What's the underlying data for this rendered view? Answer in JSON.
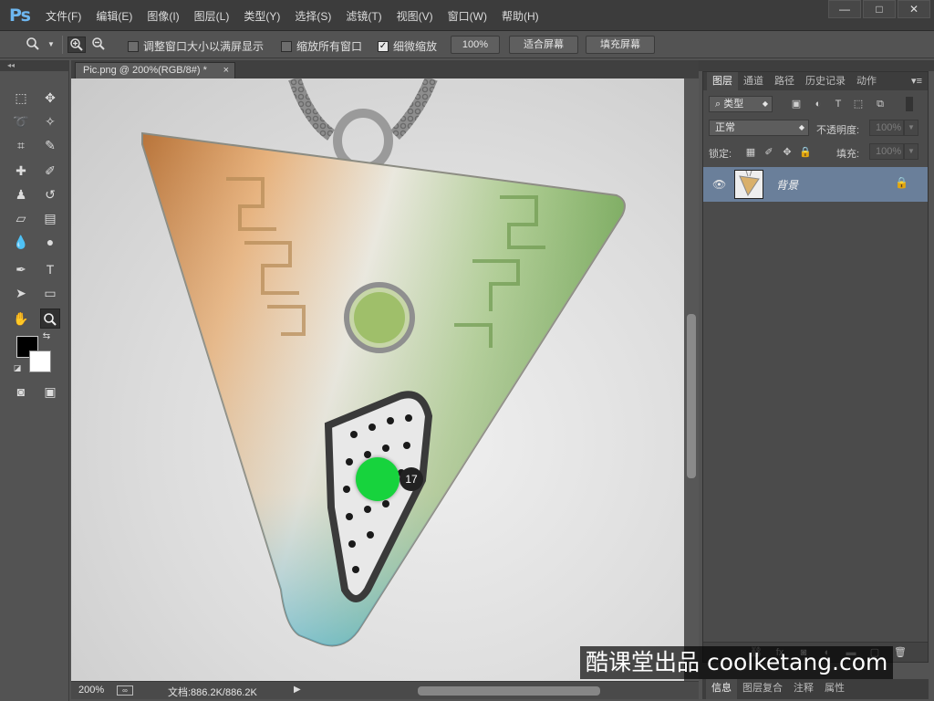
{
  "app": {
    "logo": "Ps"
  },
  "menu": [
    "文件(F)",
    "编辑(E)",
    "图像(I)",
    "图层(L)",
    "类型(Y)",
    "选择(S)",
    "滤镜(T)",
    "视图(V)",
    "窗口(W)",
    "帮助(H)"
  ],
  "window_controls": {
    "minimize": "—",
    "maximize": "□",
    "close": "✕"
  },
  "options": {
    "resize_windows": "调整窗口大小以满屏显示",
    "zoom_all": "缩放所有窗口",
    "scrubby_zoom": "细微缩放",
    "scrubby_checked": true,
    "zoom_100": "100%",
    "fit_screen": "适合屏幕",
    "fill_screen": "填充屏幕"
  },
  "document": {
    "tab_title": "Pic.png @ 200%(RGB/8#) *",
    "close": "×"
  },
  "status": {
    "zoom": "200%",
    "doc_size": "文档:886.2K/886.2K",
    "arrow": "▶"
  },
  "layers_panel": {
    "tabs": [
      "图层",
      "通道",
      "路径",
      "历史记录",
      "动作"
    ],
    "active_tab": 0,
    "kind_filter": "类型",
    "blend_mode": "正常",
    "opacity_label": "不透明度:",
    "opacity_value": "100%",
    "lock_label": "锁定:",
    "fill_label": "填充:",
    "fill_value": "100%",
    "layer_name": "背景"
  },
  "bottom_tabs": [
    "信息",
    "图层复合",
    "注释",
    "属性"
  ],
  "overlay": {
    "step_number": "17",
    "watermark": "酷课堂出品 coolketang.com"
  },
  "colors": {
    "foreground": "#000000",
    "background": "#ffffff",
    "cursor_marker": "#17d33d",
    "selected_layer": "#6a7f9a"
  }
}
